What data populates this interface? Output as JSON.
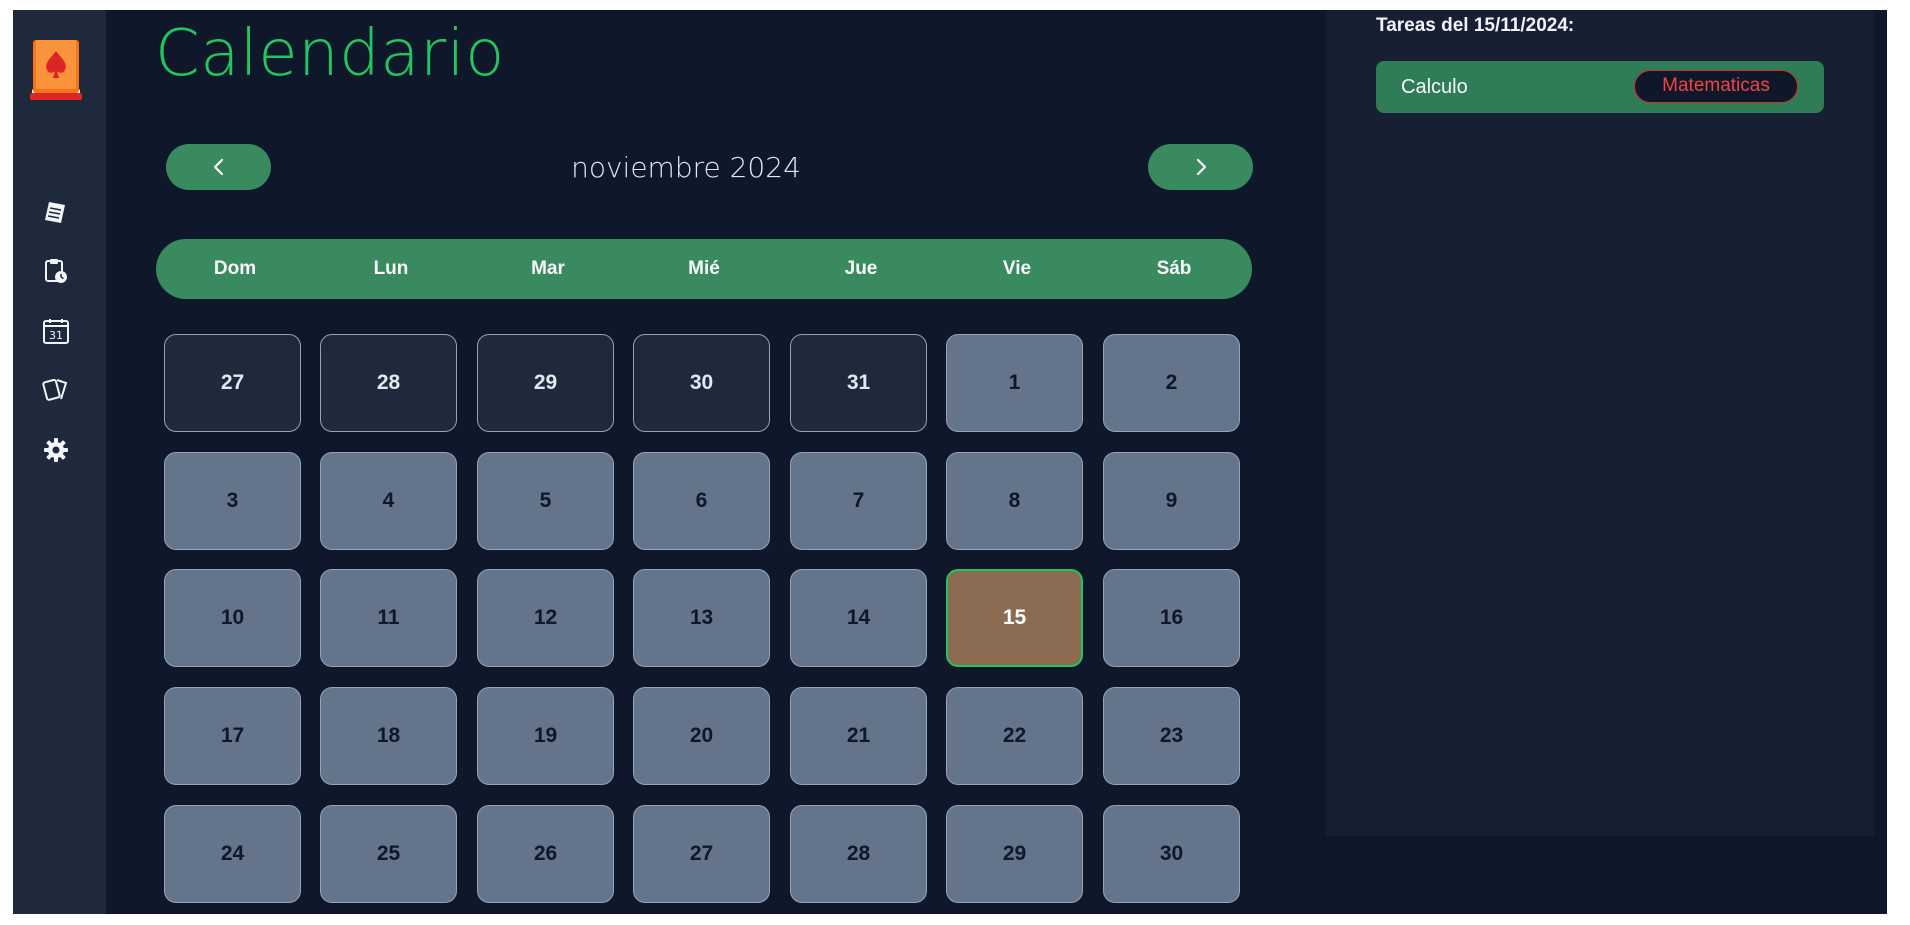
{
  "sidebar": {
    "logo": "playing-card-book-logo",
    "items": [
      {
        "icon": "notes-icon"
      },
      {
        "icon": "clipboard-clock-icon"
      },
      {
        "icon": "calendar-31-icon",
        "text": "31"
      },
      {
        "icon": "cards-icon"
      },
      {
        "icon": "gear-icon"
      }
    ]
  },
  "main": {
    "title": "Calendario",
    "month_label": "noviembre 2024",
    "prev_icon": "‹",
    "next_icon": "›",
    "weekdays": [
      "Dom",
      "Lun",
      "Mar",
      "Mié",
      "Jue",
      "Vie",
      "Sáb"
    ],
    "weeks": [
      [
        "27",
        "28",
        "29",
        "30",
        "31",
        "1",
        "2"
      ],
      [
        "3",
        "4",
        "5",
        "6",
        "7",
        "8",
        "9"
      ],
      [
        "10",
        "11",
        "12",
        "13",
        "14",
        "15",
        "16"
      ],
      [
        "17",
        "18",
        "19",
        "20",
        "21",
        "22",
        "23"
      ],
      [
        "24",
        "25",
        "26",
        "27",
        "28",
        "29",
        "30"
      ]
    ],
    "selected_day": "15"
  },
  "tasks": {
    "heading": "Tareas del 15/11/2024:",
    "items": [
      {
        "name": "Calculo",
        "subject": "Matematicas"
      }
    ]
  },
  "colors": {
    "accent_green": "#22c55e",
    "bar_green": "#3a8a60",
    "selected_day": "#8b6b52",
    "tag_red": "#ef4444"
  }
}
